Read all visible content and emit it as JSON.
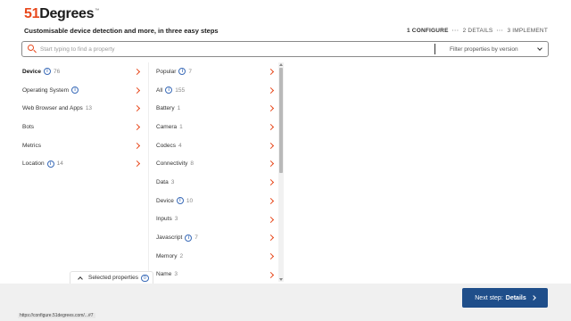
{
  "brand": {
    "logo_prefix": "51",
    "logo_main": "Degrees",
    "logo_tm": "™"
  },
  "tagline": "Customisable device detection and more, in three easy steps",
  "steps": [
    {
      "label": "1 CONFIGURE"
    },
    {
      "label": "2 DETAILS"
    },
    {
      "label": "3 IMPLEMENT"
    }
  ],
  "step_separator": "···",
  "search": {
    "placeholder": "Start typing to find a property",
    "value": ""
  },
  "filter": {
    "selected": "Filter properties by version"
  },
  "categories": [
    {
      "label": "Device",
      "count": "76",
      "has_info": true
    },
    {
      "label": "Operating System",
      "count": "",
      "has_info": true
    },
    {
      "label": "Web Browser and Apps",
      "count": "13",
      "has_info": false
    },
    {
      "label": "Bots",
      "count": "",
      "has_info": false
    },
    {
      "label": "Metrics",
      "count": "",
      "has_info": false
    },
    {
      "label": "Location",
      "count": "14",
      "has_info": true
    }
  ],
  "subcategories": [
    {
      "label": "Popular",
      "count": "7",
      "has_info": true
    },
    {
      "label": "All",
      "count": "155",
      "has_info": true
    },
    {
      "label": "Battery",
      "count": "1",
      "has_info": false
    },
    {
      "label": "Camera",
      "count": "1",
      "has_info": false
    },
    {
      "label": "Codecs",
      "count": "4",
      "has_info": false
    },
    {
      "label": "Connectivity",
      "count": "8",
      "has_info": false
    },
    {
      "label": "Data",
      "count": "3",
      "has_info": false
    },
    {
      "label": "Device",
      "count": "10",
      "has_info": true
    },
    {
      "label": "Inputs",
      "count": "3",
      "has_info": false
    },
    {
      "label": "Javascript",
      "count": "7",
      "has_info": true
    },
    {
      "label": "Memory",
      "count": "2",
      "has_info": false
    },
    {
      "label": "Name",
      "count": "3",
      "has_info": false
    }
  ],
  "selected_panel": {
    "label": "Selected properties",
    "count": "0"
  },
  "next_button": {
    "prefix": "Next step:",
    "label": "Details"
  },
  "status_url": "https://configure.51degrees.com/...#7",
  "colors": {
    "accent": "#e8491d",
    "primary": "#1f4e8a",
    "info": "#3a6bb8"
  }
}
